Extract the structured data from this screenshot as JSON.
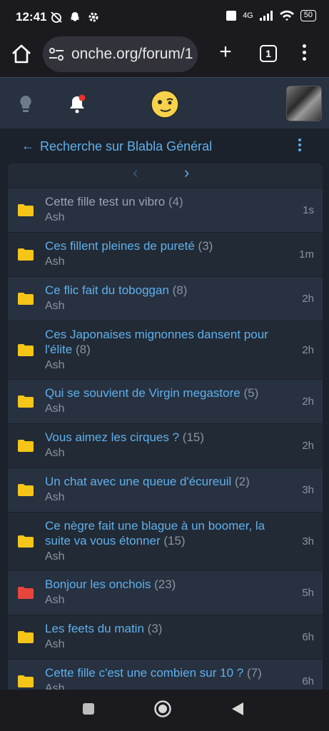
{
  "status": {
    "time": "12:41",
    "signal": "4G",
    "battery": "50"
  },
  "browser": {
    "url": "onche.org/forum/1",
    "tab_count": "1"
  },
  "header": {
    "title": "Recherche sur Blabla Général",
    "back": "←"
  },
  "pager": {
    "prev": "‹",
    "next": "›"
  },
  "topics": [
    {
      "title": "Cette fille test un vibro",
      "count": "(4)",
      "author": "Ash",
      "time": "1s",
      "folder": "yellow",
      "read": true
    },
    {
      "title": "Ces fillent pleines de pureté",
      "count": "(3)",
      "author": "Ash",
      "time": "1m",
      "folder": "yellow",
      "read": false
    },
    {
      "title": "Ce flic fait du toboggan",
      "count": "(8)",
      "author": "Ash",
      "time": "2h",
      "folder": "yellow",
      "read": false
    },
    {
      "title": "Ces Japonaises mignonnes dansent pour l'élite",
      "count": "(8)",
      "author": "Ash",
      "time": "2h",
      "folder": "yellow",
      "read": false
    },
    {
      "title": "Qui se souvient de Virgin megastore",
      "count": "(5)",
      "author": "Ash",
      "time": "2h",
      "folder": "yellow",
      "read": false
    },
    {
      "title": "Vous aimez les cirques ?",
      "count": "(15)",
      "author": "Ash",
      "time": "2h",
      "folder": "yellow",
      "read": false
    },
    {
      "title": "Un chat avec une queue d'écureuil",
      "count": "(2)",
      "author": "Ash",
      "time": "3h",
      "folder": "yellow",
      "read": false
    },
    {
      "title": "Ce nègre fait une blague à un boomer, la suite va vous étonner",
      "count": "(15)",
      "author": "Ash",
      "time": "3h",
      "folder": "yellow",
      "read": false
    },
    {
      "title": "Bonjour les onchois",
      "count": "(23)",
      "author": "Ash",
      "time": "5h",
      "folder": "red",
      "read": false
    },
    {
      "title": "Les feets du matin",
      "count": "(3)",
      "author": "Ash",
      "time": "6h",
      "folder": "yellow",
      "read": false
    },
    {
      "title": "Cette fille c'est une combien sur 10 ?",
      "count": "(7)",
      "author": "Ash",
      "time": "6h",
      "folder": "yellow",
      "read": false
    }
  ],
  "colors": {
    "link": "#5fb0ec",
    "folder_yellow": "#f5c518",
    "folder_red": "#e8453c",
    "bg": "#1c222b"
  }
}
